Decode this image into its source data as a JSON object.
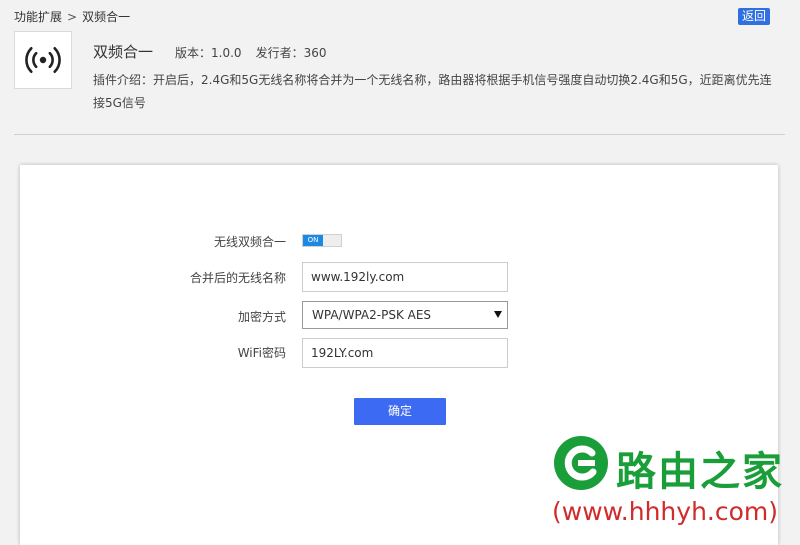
{
  "breadcrumb": {
    "parent": "功能扩展",
    "separator": ">",
    "current": "双频合一"
  },
  "back_button": "返回",
  "plugin": {
    "icon": "wireless-signal-icon",
    "name": "双频合一",
    "version_label": "版本：",
    "version": "1.0.0",
    "publisher_label": "发行者：",
    "publisher": "360",
    "description": "插件介绍：开启后，2.4G和5G无线名称将合并为一个无线名称，路由器将根据手机信号强度自动切换2.4G和5G，近距离优先连接5G信号"
  },
  "form": {
    "toggle_label": "无线双频合一",
    "toggle_state": "ON",
    "ssid_label": "合并后的无线名称",
    "ssid_value": "www.192ly.com",
    "encryption_label": "加密方式",
    "encryption_value": "WPA/WPA2-PSK AES",
    "password_label": "WiFi密码",
    "password_value": "192LY.com",
    "confirm_button": "确定"
  },
  "watermark": {
    "title": "路由之家",
    "url": "(www.hhhyh.com)"
  },
  "colors": {
    "accent": "#3d6af2",
    "back_button": "#2f6fe0",
    "toggle_on": "#1e88e5",
    "watermark_green": "#1a9e3a",
    "watermark_red": "#d12b2b"
  }
}
